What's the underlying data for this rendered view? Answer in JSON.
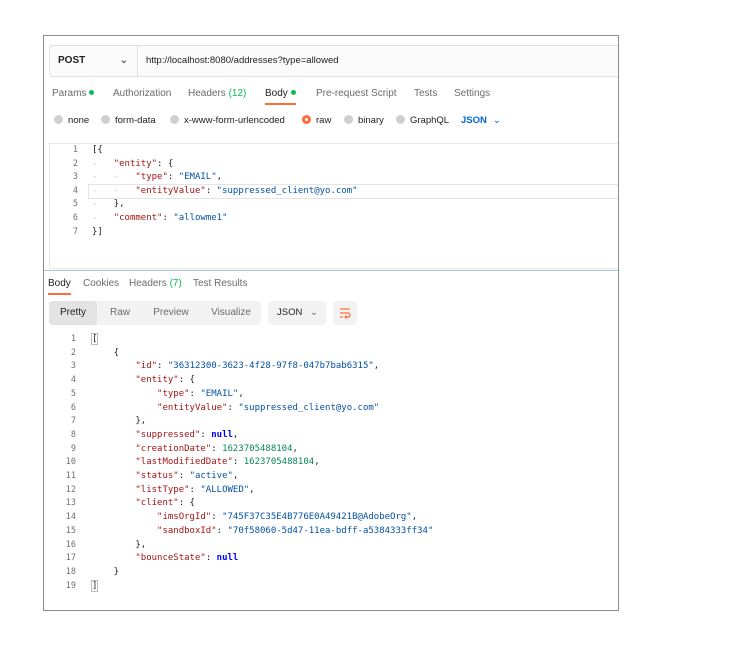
{
  "request": {
    "method": "POST",
    "url": "http://localhost:8080/addresses?type=allowed",
    "tabs": [
      {
        "label": "Params",
        "dot": true,
        "count": ""
      },
      {
        "label": "Authorization",
        "dot": false,
        "count": ""
      },
      {
        "label": "Headers",
        "dot": false,
        "count": "(12)"
      },
      {
        "label": "Body",
        "dot": true,
        "count": ""
      },
      {
        "label": "Pre-request Script",
        "dot": false,
        "count": ""
      },
      {
        "label": "Tests",
        "dot": false,
        "count": ""
      },
      {
        "label": "Settings",
        "dot": false,
        "count": ""
      }
    ],
    "active_tab": "Body",
    "body_types": [
      "none",
      "form-data",
      "x-www-form-urlencoded",
      "raw",
      "binary",
      "GraphQL"
    ],
    "selected_body_type": "raw",
    "format": "JSON",
    "body_lines": [
      "[{",
      "    \"entity\": {",
      "        \"type\": \"EMAIL\",",
      "        \"entityValue\": \"suppressed_client@yo.com\"",
      "    },",
      "    \"comment\": \"allowme1\"",
      "}]"
    ]
  },
  "response": {
    "tabs": [
      {
        "label": "Body",
        "count": ""
      },
      {
        "label": "Cookies",
        "count": ""
      },
      {
        "label": "Headers",
        "count": "(7)"
      },
      {
        "label": "Test Results",
        "count": ""
      }
    ],
    "active_tab": "Body",
    "view_modes": [
      "Pretty",
      "Raw",
      "Preview",
      "Visualize"
    ],
    "active_view": "Pretty",
    "format": "JSON",
    "body_lines": [
      "[",
      "    {",
      "        \"id\": \"36312300-3623-4f28-97f8-047b7bab6315\",",
      "        \"entity\": {",
      "            \"type\": \"EMAIL\",",
      "            \"entityValue\": \"suppressed_client@yo.com\"",
      "        },",
      "        \"suppressed\": null,",
      "        \"creationDate\": 1623705488104,",
      "        \"lastModifiedDate\": 1623705488104,",
      "        \"status\": \"active\",",
      "        \"listType\": \"ALLOWED\",",
      "        \"client\": {",
      "            \"imsOrgId\": \"745F37C35E4B776E0A49421B@AdobeOrg\",",
      "            \"sandboxId\": \"70f58060-5d47-11ea-bdff-a5384333ff34\"",
      "        },",
      "        \"bounceState\": null",
      "    }",
      "]"
    ]
  },
  "colors": {
    "accent": "#ff6c37",
    "status_dot": "#0cbb52",
    "link_blue": "#0265d2"
  },
  "icons": {
    "method_dropdown": "chevron-down-icon",
    "format_dropdown": "chevron-down-icon",
    "wrap": "wrap-lines-icon"
  }
}
